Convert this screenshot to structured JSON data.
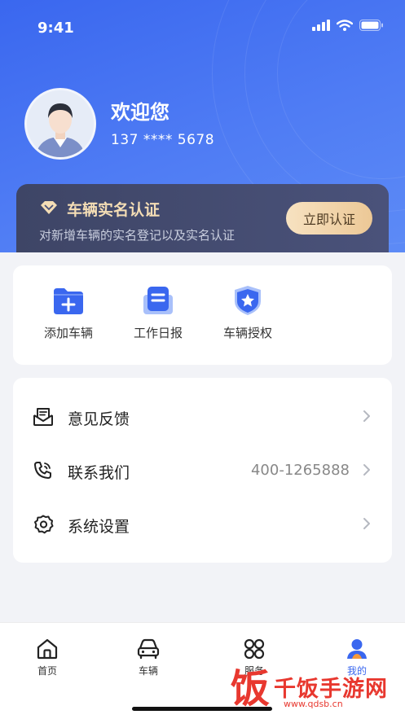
{
  "status_bar": {
    "time": "9:41"
  },
  "profile": {
    "greeting": "欢迎您",
    "phone": "137 **** 5678"
  },
  "verify_banner": {
    "title": "车辆实名认证",
    "subtitle": "对新增车辆的实名登记以及实名认证",
    "button_label": "立即认证"
  },
  "quick_actions": [
    {
      "label": "添加车辆",
      "icon": "add-folder-icon"
    },
    {
      "label": "工作日报",
      "icon": "daily-report-icon"
    },
    {
      "label": "车辆授权",
      "icon": "shield-star-icon"
    }
  ],
  "menu": [
    {
      "label": "意见反馈",
      "value": "",
      "icon": "feedback-icon"
    },
    {
      "label": "联系我们",
      "value": "400-1265888",
      "icon": "phone-icon"
    },
    {
      "label": "系统设置",
      "value": "",
      "icon": "gear-icon"
    }
  ],
  "tabs": [
    {
      "label": "首页",
      "icon": "home-icon",
      "active": false
    },
    {
      "label": "车辆",
      "icon": "car-icon",
      "active": false
    },
    {
      "label": "服务",
      "icon": "grid-icon",
      "active": false
    },
    {
      "label": "我的",
      "icon": "user-icon",
      "active": true
    }
  ],
  "watermark": {
    "char": "饭",
    "text": "千饭手游网",
    "url": "www.qdsb.cn"
  },
  "colors": {
    "primary": "#3a67ef",
    "banner_dark": "#3e4566",
    "gold": "#ecc896"
  }
}
